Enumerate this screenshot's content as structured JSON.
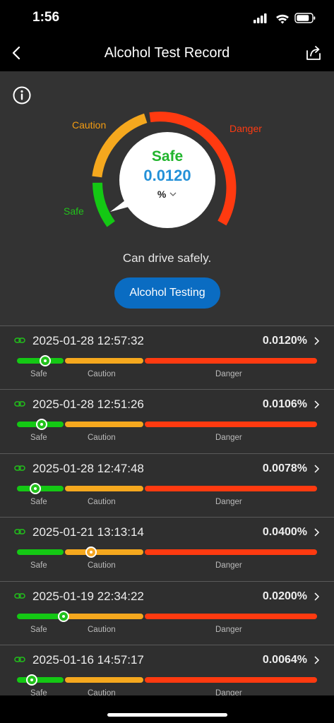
{
  "status_bar": {
    "time": "1:56"
  },
  "nav": {
    "title": "Alcohol Test Record",
    "back_icon": "chevron-left-icon",
    "share_icon": "share-icon"
  },
  "gauge": {
    "status": "Safe",
    "value": "0.0120",
    "unit": "%",
    "zone_labels": {
      "safe": "Safe",
      "caution": "Caution",
      "danger": "Danger"
    },
    "colors": {
      "safe": "#22c11b",
      "caution": "#f5a623",
      "danger": "#ff3a10",
      "value": "#2491d8"
    }
  },
  "advice": "Can drive safely.",
  "test_button": "Alcohol Testing",
  "record_labels": {
    "safe": "Safe",
    "caution": "Caution",
    "danger": "Danger"
  },
  "records": [
    {
      "datetime": "2025-01-28 12:57:32",
      "value": "0.0120%",
      "level": 0.012,
      "zone": "safe"
    },
    {
      "datetime": "2025-01-28 12:51:26",
      "value": "0.0106%",
      "level": 0.0106,
      "zone": "safe"
    },
    {
      "datetime": "2025-01-28 12:47:48",
      "value": "0.0078%",
      "level": 0.0078,
      "zone": "safe"
    },
    {
      "datetime": "2025-01-21 13:13:14",
      "value": "0.0400%",
      "level": 0.04,
      "zone": "caution"
    },
    {
      "datetime": "2025-01-19 22:34:22",
      "value": "0.0200%",
      "level": 0.02,
      "zone": "safe"
    },
    {
      "datetime": "2025-01-16 14:57:17",
      "value": "0.0064%",
      "level": 0.0064,
      "zone": "safe"
    }
  ]
}
